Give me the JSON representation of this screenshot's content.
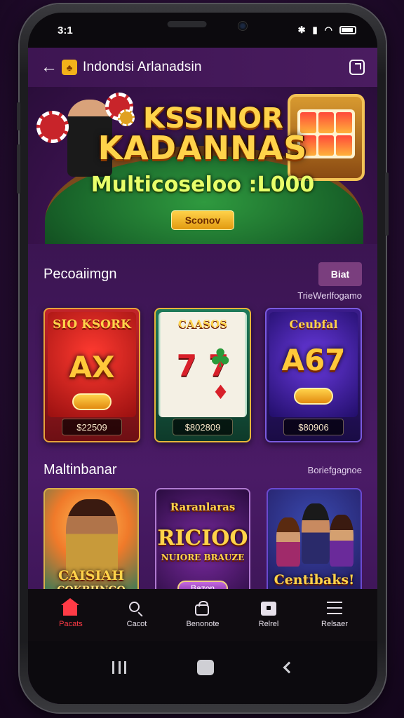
{
  "status_bar": {
    "time": "3:1"
  },
  "header": {
    "title": "Indondsi Arlanadsin",
    "logo_glyph": "♣"
  },
  "banner": {
    "title_line1": "KSSINOR",
    "title_line2": "KADANNAS",
    "subtitle": "Multicoseloo :L000",
    "button_label": "Sconov"
  },
  "section1": {
    "title": "Pecoaiimgn",
    "button_label": "Biat",
    "link": "TrieWerlfogamo",
    "cards": [
      {
        "top": "SIO KSORK",
        "main": "AX",
        "price": "$22509"
      },
      {
        "top": "CAASOS",
        "main": "77",
        "price": "$802809"
      },
      {
        "top": "Ceubfal",
        "main": "A67",
        "price": "$80906"
      }
    ]
  },
  "section2": {
    "title": "Maltinbanar",
    "link": "Boriefgagnoe",
    "cards": [
      {
        "title": "CAISIAH",
        "subtitle": "COKBIINGO"
      },
      {
        "title": "Raranlaras",
        "main": "RICIOO",
        "subtitle": "NUIORE BRAUZE",
        "button": "Bazon"
      },
      {
        "title": "Centibaks!"
      }
    ]
  },
  "bottom_nav": [
    {
      "label": "Pacats",
      "icon": "home-icon",
      "active": true
    },
    {
      "label": "Cacot",
      "icon": "search-icon"
    },
    {
      "label": "Benonote",
      "icon": "bag-icon"
    },
    {
      "label": "Relrel",
      "icon": "card-icon"
    },
    {
      "label": "Relsaer",
      "icon": "menu-icon"
    }
  ],
  "colors": {
    "accent": "#ff3b46",
    "background": "#3a1650",
    "gold": "#ffd34a"
  }
}
